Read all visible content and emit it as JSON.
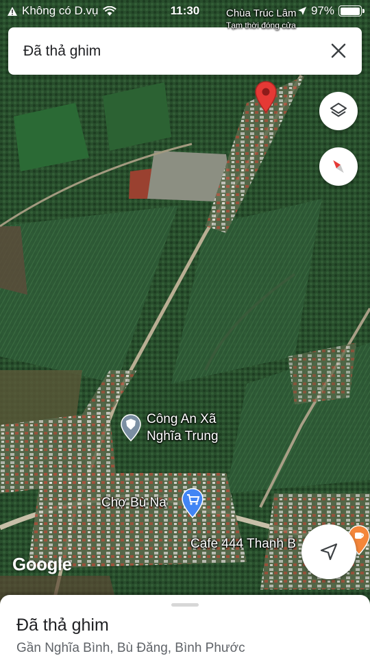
{
  "status_bar": {
    "carrier": "Không có D.vụ",
    "time": "11:30",
    "battery": "97%",
    "battery_level": 0.97,
    "icons": [
      "warning-icon",
      "wifi-icon",
      "location-arrow-icon",
      "battery-icon"
    ]
  },
  "search": {
    "title": "Đã thả ghim",
    "close_icon": "close-icon"
  },
  "map": {
    "top_place_label": "Chùa Trúc Lâm",
    "top_place_sub": "Tạm thời đóng cửa",
    "labels": {
      "police": [
        "Công An Xã",
        "Nghĩa Trung"
      ],
      "market": "Chợ Bù Na",
      "cafe": "Cafe 444 Thanh B"
    },
    "attribution": "Google",
    "colors": {
      "pin": "#e53935",
      "market_icon": "#4285f4",
      "cafe_icon": "#f4863a"
    },
    "buttons": [
      "layers-icon",
      "compass-icon",
      "my-location-icon"
    ]
  },
  "sheet": {
    "title": "Đã thả ghim",
    "subtitle": "Gần Nghĩa Bình, Bù Đăng, Bình Phước"
  }
}
